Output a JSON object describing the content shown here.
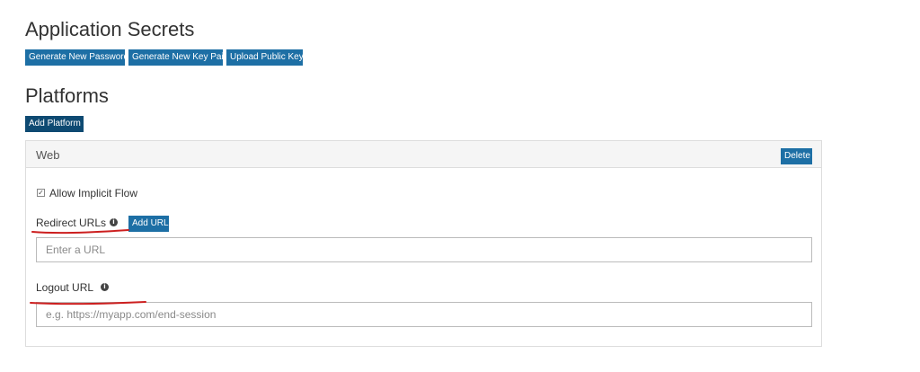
{
  "app_secrets": {
    "title": "Application Secrets",
    "buttons": {
      "generate_password": "Generate New Password",
      "generate_key_pair": "Generate New Key Pair",
      "upload_public_key": "Upload Public Key"
    }
  },
  "platforms": {
    "title": "Platforms",
    "add_platform": "Add Platform",
    "web": {
      "title": "Web",
      "delete": "Delete",
      "implicit_flow": {
        "label": "Allow Implicit Flow",
        "checked": true,
        "check_glyph": "✓"
      },
      "redirect": {
        "label": "Redirect URLs",
        "info_glyph": "i",
        "add_url": "Add URL",
        "placeholder": "Enter a URL",
        "value": ""
      },
      "logout": {
        "label": "Logout URL",
        "info_glyph": "i",
        "placeholder": "e.g. https://myapp.com/end-session",
        "value": ""
      }
    }
  },
  "colors": {
    "button": "#1d6fa5",
    "button_dark": "#0e4a72",
    "annotation": "#cc1f1f"
  },
  "icons": {
    "info": "info-circle-icon",
    "checkbox": "check-icon"
  }
}
